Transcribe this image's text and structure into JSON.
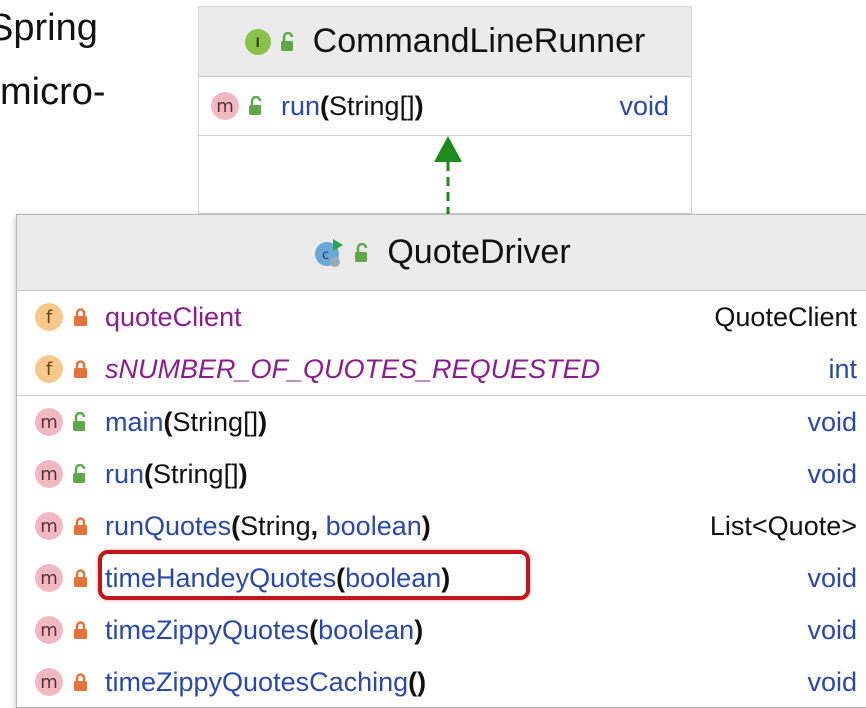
{
  "slide": {
    "line1": "Spring",
    "line2": "micro-"
  },
  "interface_box": {
    "badge": "I",
    "title": "CommandLineRunner",
    "methods": [
      {
        "badge": "m",
        "name": "run",
        "open": "(",
        "params": "String[]",
        "close": ")",
        "return": "void"
      }
    ]
  },
  "class_box": {
    "title": "QuoteDriver",
    "fields": [
      {
        "badge": "f",
        "name": "quoteClient",
        "type": "QuoteClient"
      },
      {
        "badge": "f",
        "name": "sNUMBER_OF_QUOTES_REQUESTED",
        "type": "int"
      }
    ],
    "methods": [
      {
        "badge": "m",
        "name": "main",
        "params_a": "String[]",
        "params_b": "",
        "return": "void"
      },
      {
        "badge": "m",
        "name": "run",
        "params_a": "String[]",
        "params_b": "",
        "return": "void"
      },
      {
        "badge": "m",
        "name": "runQuotes",
        "params_a": "String",
        "params_b": "boolean",
        "return": "List<Quote>"
      },
      {
        "badge": "m",
        "name": "timeHandeyQuotes",
        "params_a": "",
        "params_b": "boolean",
        "return": "void"
      },
      {
        "badge": "m",
        "name": "timeZippyQuotes",
        "params_a": "",
        "params_b": "boolean",
        "return": "void"
      },
      {
        "badge": "m",
        "name": "timeZippyQuotesCaching",
        "params_a": "",
        "params_b": "",
        "return": "void"
      }
    ]
  },
  "colors": {
    "arrow": "#1e8a1e",
    "highlight": "#c0151b",
    "method_name": "#2a48a8",
    "field_name": "#8a1d8e"
  }
}
